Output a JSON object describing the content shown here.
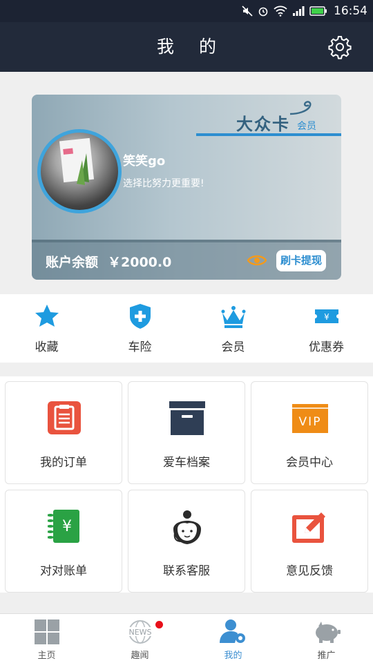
{
  "status_bar": {
    "time": "16:54"
  },
  "header": {
    "title": "我 的"
  },
  "card": {
    "brand": "大众卡",
    "member_label": "会员",
    "user_name": "笑笑go",
    "motto": "选择比努力更重要!",
    "balance_label": "账户余额",
    "balance_value": "￥2000.0",
    "withdraw_label": "刷卡提现"
  },
  "quick": [
    {
      "label": "收藏",
      "icon": "star-icon"
    },
    {
      "label": "车险",
      "icon": "shield-plus-icon"
    },
    {
      "label": "会员",
      "icon": "crown-icon"
    },
    {
      "label": "优惠券",
      "icon": "coupon-icon"
    }
  ],
  "grid": [
    {
      "label": "我的订单",
      "icon": "order-icon",
      "color": "#e9533e"
    },
    {
      "label": "爱车档案",
      "icon": "archive-box-icon",
      "color": "#2f3e55"
    },
    {
      "label": "会员中心",
      "icon": "vip-icon",
      "color": "#ef8c16"
    },
    {
      "label": "对对账单",
      "icon": "bill-icon",
      "color": "#2aa244"
    },
    {
      "label": "联系客服",
      "icon": "customer-service-icon",
      "color": "#2b2b2b"
    },
    {
      "label": "意见反馈",
      "icon": "feedback-edit-icon",
      "color": "#e9533e"
    }
  ],
  "tabs": [
    {
      "label": "主页",
      "icon": "home-grid-icon"
    },
    {
      "label": "趣闻",
      "icon": "news-globe-icon"
    },
    {
      "label": "我的",
      "icon": "user-gear-icon",
      "active": true
    },
    {
      "label": "推广",
      "icon": "piggy-bank-icon"
    }
  ],
  "colors": {
    "accent": "#3d8fd1",
    "header": "#222a3a",
    "quick_icon": "#1e9be0"
  }
}
